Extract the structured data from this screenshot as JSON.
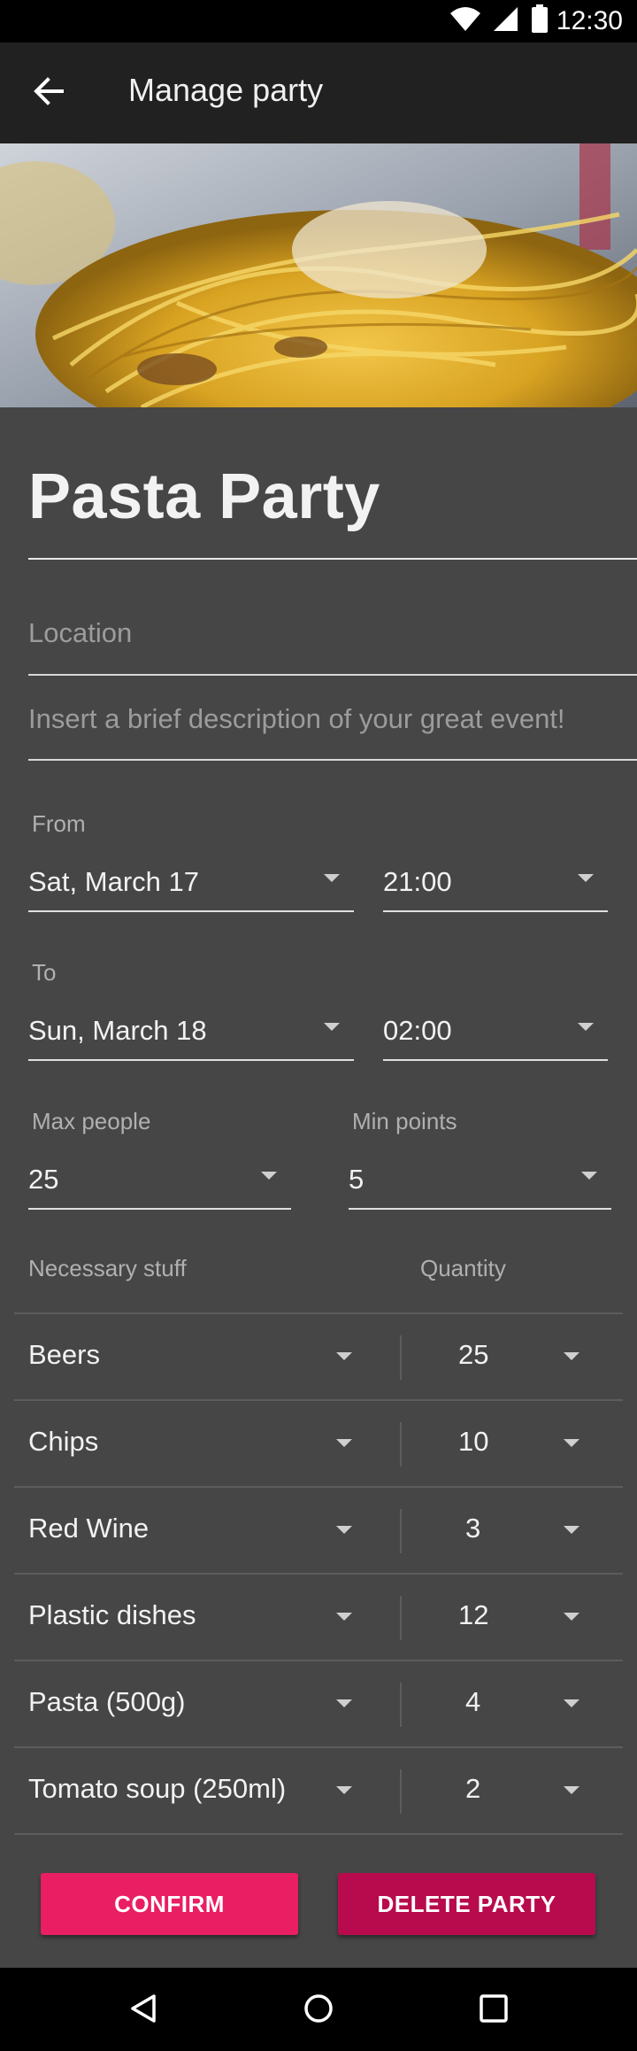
{
  "status_bar": {
    "time": "12:30"
  },
  "app_bar": {
    "title": "Manage party"
  },
  "party": {
    "title": "Pasta Party"
  },
  "location": {
    "placeholder": "Location"
  },
  "description": {
    "placeholder": "Insert a brief description of your great event!"
  },
  "from": {
    "label": "From",
    "date": "Sat, March 17",
    "time": "21:00"
  },
  "to": {
    "label": "To",
    "date": "Sun, March 18",
    "time": "02:00"
  },
  "max_people": {
    "label": "Max people",
    "value": "25"
  },
  "min_points": {
    "label": "Min points",
    "value": "5"
  },
  "stuff": {
    "header_item": "Necessary stuff",
    "header_quantity": "Quantity",
    "rows": [
      {
        "item": "Beers",
        "quantity": "25"
      },
      {
        "item": "Chips",
        "quantity": "10"
      },
      {
        "item": "Red Wine",
        "quantity": "3"
      },
      {
        "item": "Plastic dishes",
        "quantity": "12"
      },
      {
        "item": "Pasta (500g)",
        "quantity": "4"
      },
      {
        "item": "Tomato soup (250ml)",
        "quantity": "2"
      }
    ]
  },
  "buttons": {
    "confirm": "CONFIRM",
    "delete": "DELETE PARTY"
  },
  "colors": {
    "accent": "#e91e63",
    "accent_dark": "#b80b4d",
    "background": "#464646",
    "app_bar": "#212121"
  },
  "icons": [
    "wifi-icon",
    "cell-signal-icon",
    "battery-icon",
    "back-arrow-icon",
    "dropdown-caret-icon",
    "nav-back-icon",
    "nav-home-icon",
    "nav-recents-icon"
  ]
}
